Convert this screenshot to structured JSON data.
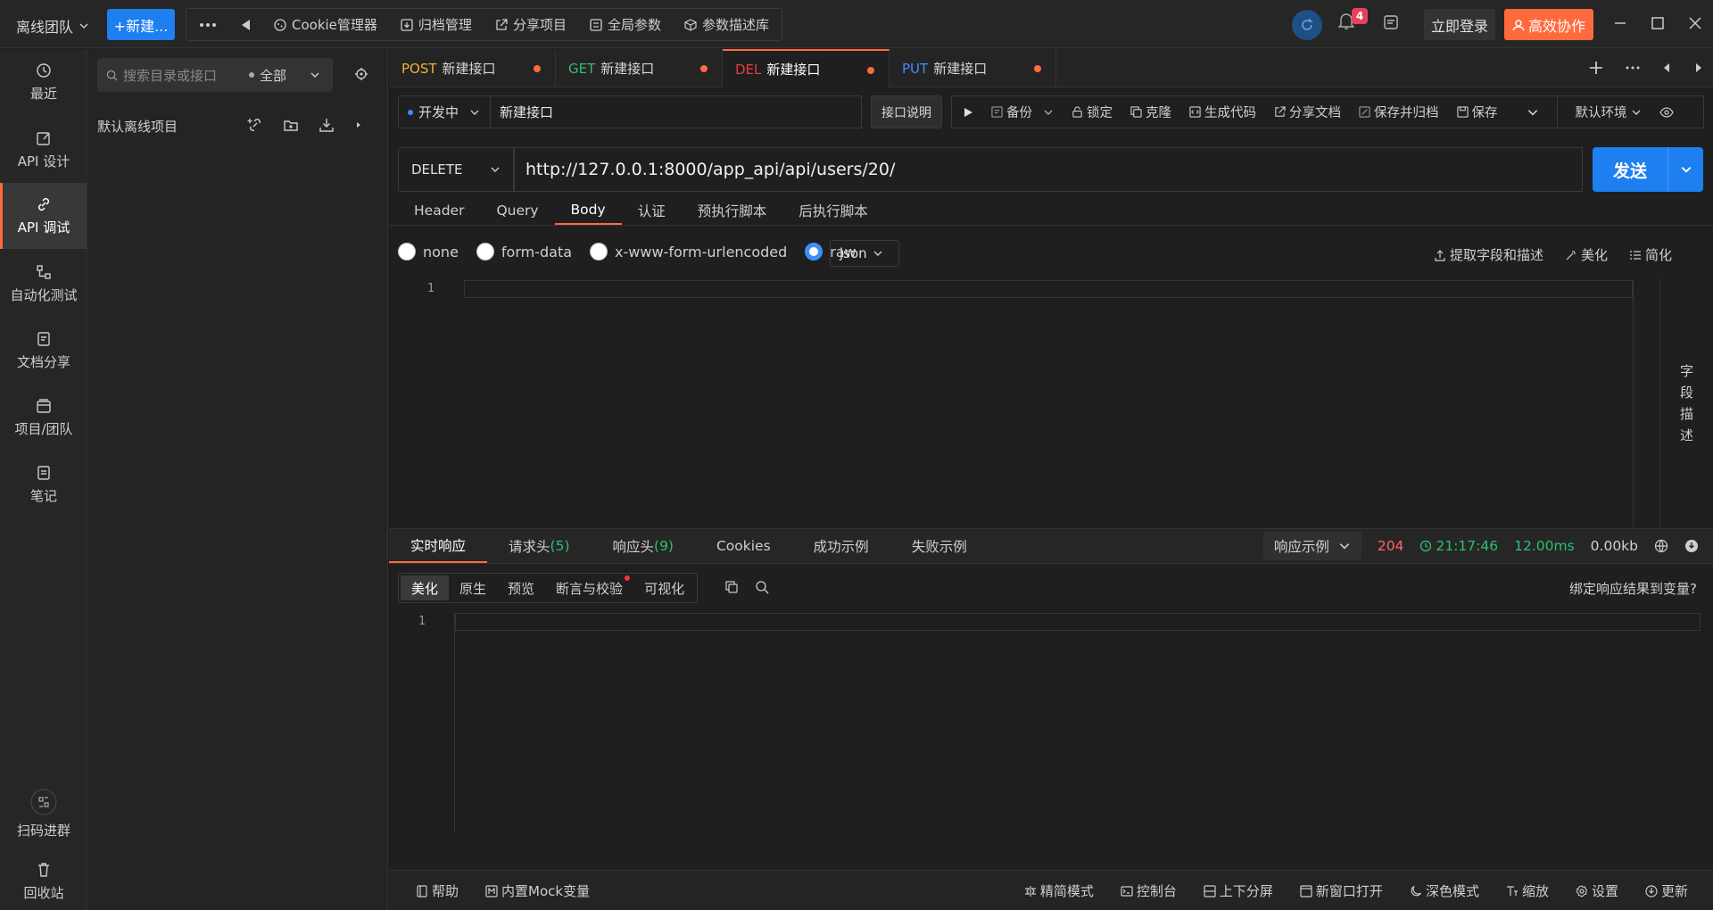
{
  "topbar": {
    "team": "离线团队",
    "new_label": "+新建...",
    "tools": [
      "Cookie管理器",
      "归档管理",
      "分享项目",
      "全局参数",
      "参数描述库"
    ],
    "notification_count": "4",
    "login_label": "立即登录",
    "collab_label": "高效协作"
  },
  "nav": {
    "items": [
      {
        "label": "最近",
        "icon": "clock-icon"
      },
      {
        "label": "API 设计",
        "icon": "edit-icon"
      },
      {
        "label": "API 调试",
        "icon": "link-icon"
      },
      {
        "label": "自动化测试",
        "icon": "flow-icon"
      },
      {
        "label": "文档分享",
        "icon": "doc-icon"
      },
      {
        "label": "项目/团队",
        "icon": "folder-icon"
      },
      {
        "label": "笔记",
        "icon": "note-icon"
      }
    ],
    "scan_label": "扫码进群",
    "trash_label": "回收站"
  },
  "tree": {
    "search_placeholder": "搜索目录或接口",
    "filter": "全部",
    "project": "默认离线项目"
  },
  "tabs": [
    {
      "method": "POST",
      "name": "新建接口"
    },
    {
      "method": "GET",
      "name": "新建接口"
    },
    {
      "method": "DEL",
      "name": "新建接口"
    },
    {
      "method": "PUT",
      "name": "新建接口"
    }
  ],
  "request": {
    "status": "开发中",
    "name": "新建接口",
    "desc_label": "接口说明",
    "actions": {
      "backup": "备份",
      "lock": "锁定",
      "clone": "克隆",
      "codegen": "生成代码",
      "share": "分享文档",
      "save_archive": "保存并归档",
      "save": "保存",
      "env": "默认环境"
    },
    "method": "DELETE",
    "url": "http://127.0.0.1:8000/app_api/api/users/20/",
    "send_label": "发送",
    "sub_tabs": [
      "Header",
      "Query",
      "Body",
      "认证",
      "预执行脚本",
      "后执行脚本"
    ],
    "body_types": [
      "none",
      "form-data",
      "x-www-form-urlencoded",
      "raw"
    ],
    "body_format": "json",
    "body_tools": {
      "extract": "提取字段和描述",
      "beautify": "美化",
      "simplify": "简化"
    },
    "line_number": "1",
    "field_desc": [
      "字",
      "段",
      "描",
      "述"
    ]
  },
  "response": {
    "tabs": {
      "live": "实时响应",
      "req_headers": "请求头",
      "req_headers_count": "(5)",
      "resp_headers": "响应头",
      "resp_headers_count": "(9)",
      "cookies": "Cookies",
      "success": "成功示例",
      "fail": "失败示例"
    },
    "example_label": "响应示例",
    "status_code": "204",
    "time": "21:17:46",
    "duration": "12.00ms",
    "size": "0.00kb",
    "view_tabs": [
      "美化",
      "原生",
      "预览",
      "断言与校验",
      "可视化"
    ],
    "bind_label": "绑定响应结果到变量?",
    "line_number": "1"
  },
  "bottom": {
    "help": "帮助",
    "mock": "内置Mock变量",
    "simple_mode": "精简模式",
    "console": "控制台",
    "split": "上下分屏",
    "new_window": "新窗口打开",
    "dark_mode": "深色模式",
    "zoom": "缩放",
    "settings": "设置",
    "update": "更新"
  }
}
